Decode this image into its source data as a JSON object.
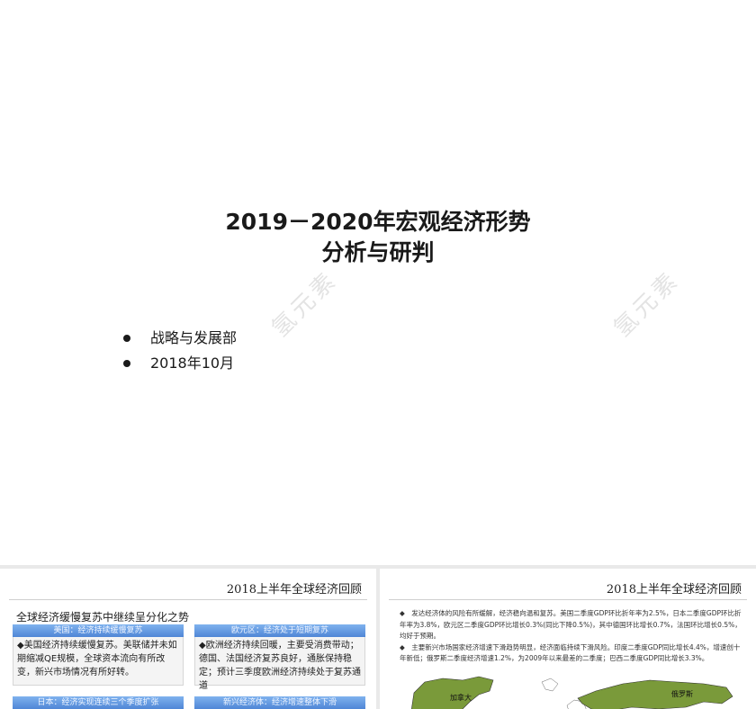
{
  "slide_main": {
    "title_line1": "2019－2020年宏观经济形势",
    "title_line2": "分析与研判",
    "bullets": [
      "战略与发展部",
      "2018年10月"
    ],
    "watermark": "氢元素"
  },
  "thumb_left": {
    "title": "2018上半年全球经济回顾",
    "heading": "全球经济缓慢复苏中继续呈分化之势",
    "boxes": [
      {
        "head": "美国：经济持续缓慢复苏",
        "body": "◆美国经济持续缓慢复苏。美联储并未如期缩减QE规模，全球资本流向有所改变，新兴市场情况有所好转。"
      },
      {
        "head": "欧元区：经济处于短期复苏",
        "body": "◆欧洲经济持续回暖，主要受消费带动；德国、法国经济复苏良好，通胀保持稳定；预计三季度欧洲经济持续处于复苏通道"
      },
      {
        "head": "日本：经济实现连续三个季度扩张",
        "body": ""
      },
      {
        "head": "新兴经济体：经济增速整体下滑",
        "body": ""
      }
    ]
  },
  "thumb_right": {
    "title": "2018上半年全球经济回顾",
    "paragraphs": [
      "◆　发达经济体的风险有所缓解，经济稳向温和复苏。美国二季度GDP环比折年率为2.5%，日本二季度GDP环比折年率为3.8%，欧元区二季度GDP环比增长0.3%(同比下降0.5%)，其中德国环比增长0.7%，法国环比增长0.5%，均好于预期。",
      "◆　主要新兴市场国家经济增速下滑趋势明显，经济面临持续下滑风险。印度二季度GDP同比增长4.4%，增速创十年新低；俄罗斯二季度经济增速1.2%，为2009年以来最差的二季度；巴西二季度GDP同比增长3.3%。"
    ],
    "map_labels": [
      "加拿大",
      "俄罗斯"
    ]
  },
  "colors": {
    "box_header": "#4f86d6",
    "map_land": "#7a9a3a"
  }
}
